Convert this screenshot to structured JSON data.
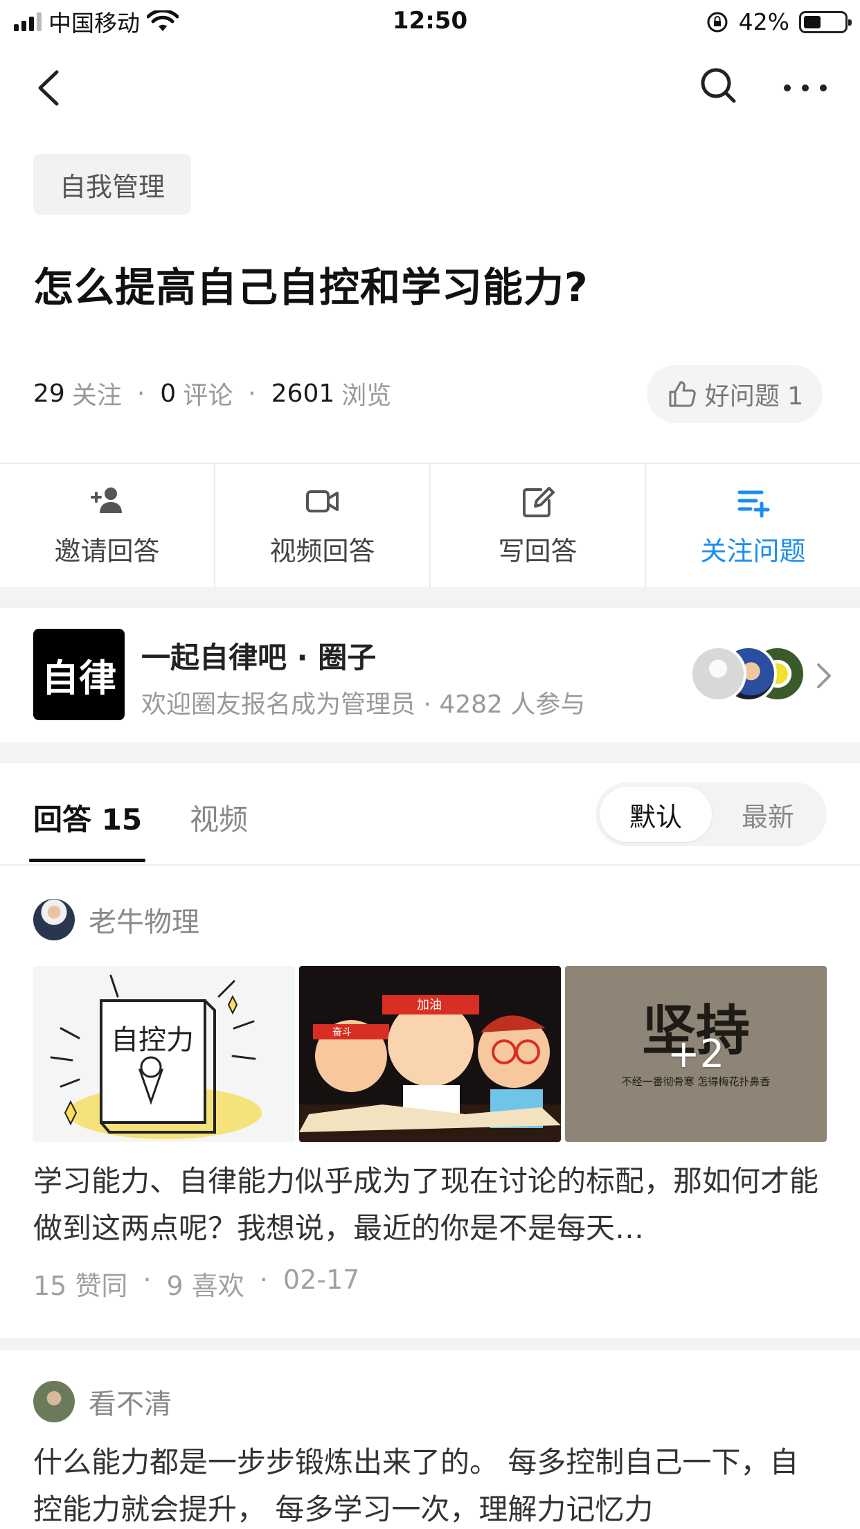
{
  "status_bar": {
    "carrier": "中国移动",
    "time": "12:50",
    "battery": "42%",
    "battery_level": 0.42
  },
  "nav": {
    "back_icon": "chevron-left-icon",
    "search_icon": "search-icon",
    "more_icon": "more-icon"
  },
  "question": {
    "topic": "自我管理",
    "title": "怎么提高自己自控和学习能力?",
    "follow_count": "29",
    "follow_label": "关注",
    "comment_count": "0",
    "comment_label": "评论",
    "view_count": "2601",
    "view_label": "浏览",
    "good_question": "好问题 1"
  },
  "actions": [
    {
      "label": "邀请回答",
      "icon": "add-person-icon"
    },
    {
      "label": "视频回答",
      "icon": "video-icon"
    },
    {
      "label": "写回答",
      "icon": "edit-icon"
    },
    {
      "label": "关注问题",
      "icon": "follow-list-icon"
    }
  ],
  "circle": {
    "logo_text": "自律",
    "name": "一起自律吧 · 圈子",
    "subtitle": "欢迎圈友报名成为管理员 · 4282 人参与"
  },
  "tabs": {
    "answers": "回答 15",
    "video": "视频",
    "sort_default": "默认",
    "sort_newest": "最新"
  },
  "answers": [
    {
      "author": "老牛物理",
      "images_more": "+2",
      "excerpt": "学习能力、自律能力似乎成为了现在讨论的标配，那如何才能做到这两点呢？我想说，最近的你是不是每天…",
      "likes": "15 赞同",
      "favorites": "9 喜欢",
      "date": "02-17"
    },
    {
      "author": "看不清",
      "excerpt": "什么能力都是一步步锻炼出来了的。 每多控制自己一下，自控能力就会提升， 每多学习一次，理解力记忆力"
    }
  ],
  "image_texts": {
    "img1": "自控力",
    "img2_band_left": "奋斗",
    "img2_band_mid": "加油",
    "img3_title": "坚持",
    "img3_sub": "不经一番彻骨寒 怎得梅花扑鼻香"
  },
  "colors": {
    "accent": "#1a8ef0",
    "muted": "#999999",
    "band": "#f3f3f3"
  }
}
